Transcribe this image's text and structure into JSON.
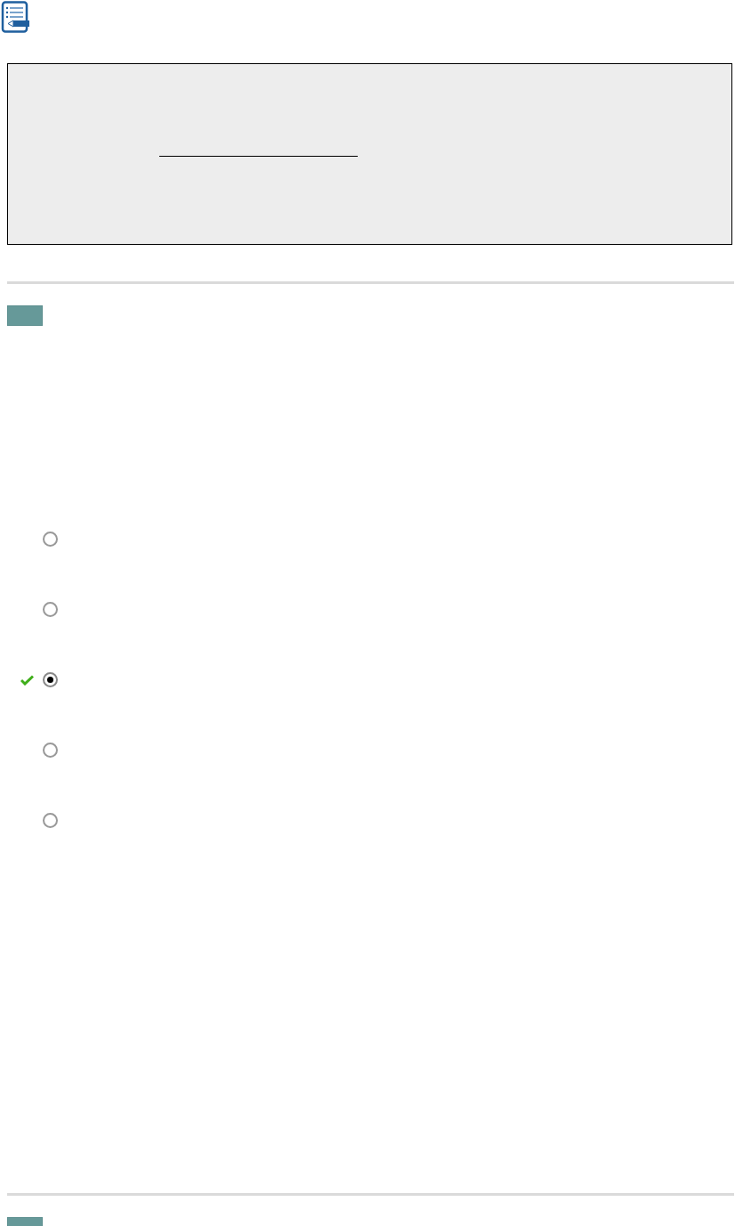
{
  "prompt_box": {
    "blank": {
      "kind": "fill_in"
    }
  },
  "questions": [
    {
      "kind": "choice",
      "options": [
        {
          "selected": false,
          "correct": false
        },
        {
          "selected": false,
          "correct": false
        },
        {
          "selected": true,
          "correct": true
        },
        {
          "selected": false,
          "correct": false
        },
        {
          "selected": false,
          "correct": false
        }
      ]
    },
    {
      "kind": "empty"
    }
  ]
}
